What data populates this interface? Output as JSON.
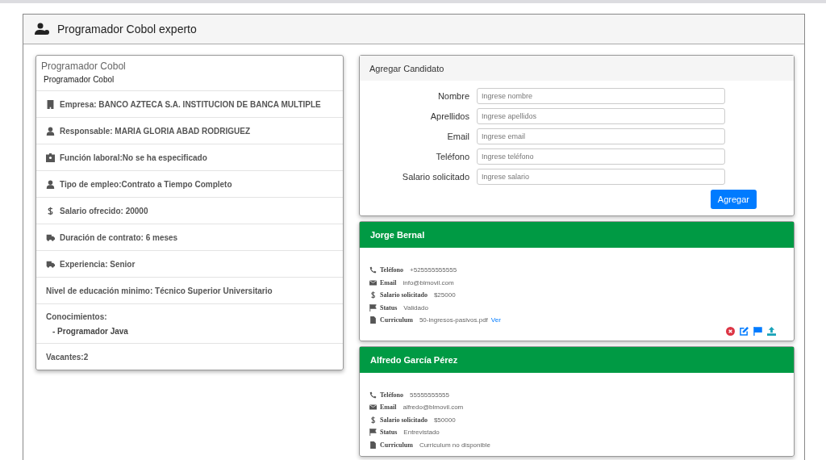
{
  "page_title": "Programador Cobol experto",
  "job": {
    "title": "Programador Cobol",
    "subtitle": "Programador Cobol",
    "details": [
      {
        "kind": "building",
        "text": "Empresa: BANCO AZTECA S.A. INSTITUCION DE BANCA MULTIPLE"
      },
      {
        "kind": "user",
        "text": "Responsable: MARIA GLORIA ABAD RODRIGUEZ"
      },
      {
        "kind": "badge",
        "text": "Función laboral:No se ha especificado"
      },
      {
        "kind": "user",
        "text": "Tipo de empleo:Contrato a Tiempo Completo"
      },
      {
        "kind": "dollar",
        "text": "Salario ofrecido: 20000"
      },
      {
        "kind": "truck",
        "text": "Duración de contrato: 6 meses"
      },
      {
        "kind": "truck",
        "text": "Experiencia: Senior"
      },
      {
        "kind": "plain",
        "text": "Nivel de educación minimo: Técnico Superior Universitario"
      }
    ],
    "knowledge_title": "Conocimientos:",
    "knowledge": [
      "- Programador Java"
    ],
    "vacancies": "Vacantes:2"
  },
  "form": {
    "title": "Agregar Candidato",
    "fields": [
      {
        "label": "Nombre",
        "placeholder": "Ingrese nombre"
      },
      {
        "label": "Aprellidos",
        "placeholder": "Ingrese apellidos"
      },
      {
        "label": "Email",
        "placeholder": "Ingrese email"
      },
      {
        "label": "Teléfono",
        "placeholder": "Ingrese teléfono"
      },
      {
        "label": "Salario solicitado",
        "placeholder": "Ingrese salario"
      }
    ],
    "button": "Agregar"
  },
  "candidates": [
    {
      "name": "Jorge Bernal",
      "rows": [
        {
          "kind": "phone",
          "label": "Teléfono",
          "value": "+525555555555"
        },
        {
          "kind": "email",
          "label": "Email",
          "value": "info@blmovil.com"
        },
        {
          "kind": "salary",
          "label": "Salario solicitado",
          "value": "$25000"
        },
        {
          "kind": "status",
          "label": "Status",
          "value": "Validado"
        },
        {
          "kind": "cv",
          "label": "Curriculum",
          "value": "50-ingresos-pasivos.pdf",
          "link": "Ver"
        }
      ],
      "actions": true
    },
    {
      "name": "Alfredo García Pérez",
      "rows": [
        {
          "kind": "phone",
          "label": "Teléfono",
          "value": "55555555555"
        },
        {
          "kind": "email",
          "label": "Email",
          "value": "alfredo@blmovil.com"
        },
        {
          "kind": "salary",
          "label": "Salario solicitado",
          "value": "$50000"
        },
        {
          "kind": "status",
          "label": "Status",
          "value": "Entrevistado"
        },
        {
          "kind": "cv",
          "label": "Curriculum",
          "value": "Curriculum no disponible"
        }
      ]
    }
  ]
}
